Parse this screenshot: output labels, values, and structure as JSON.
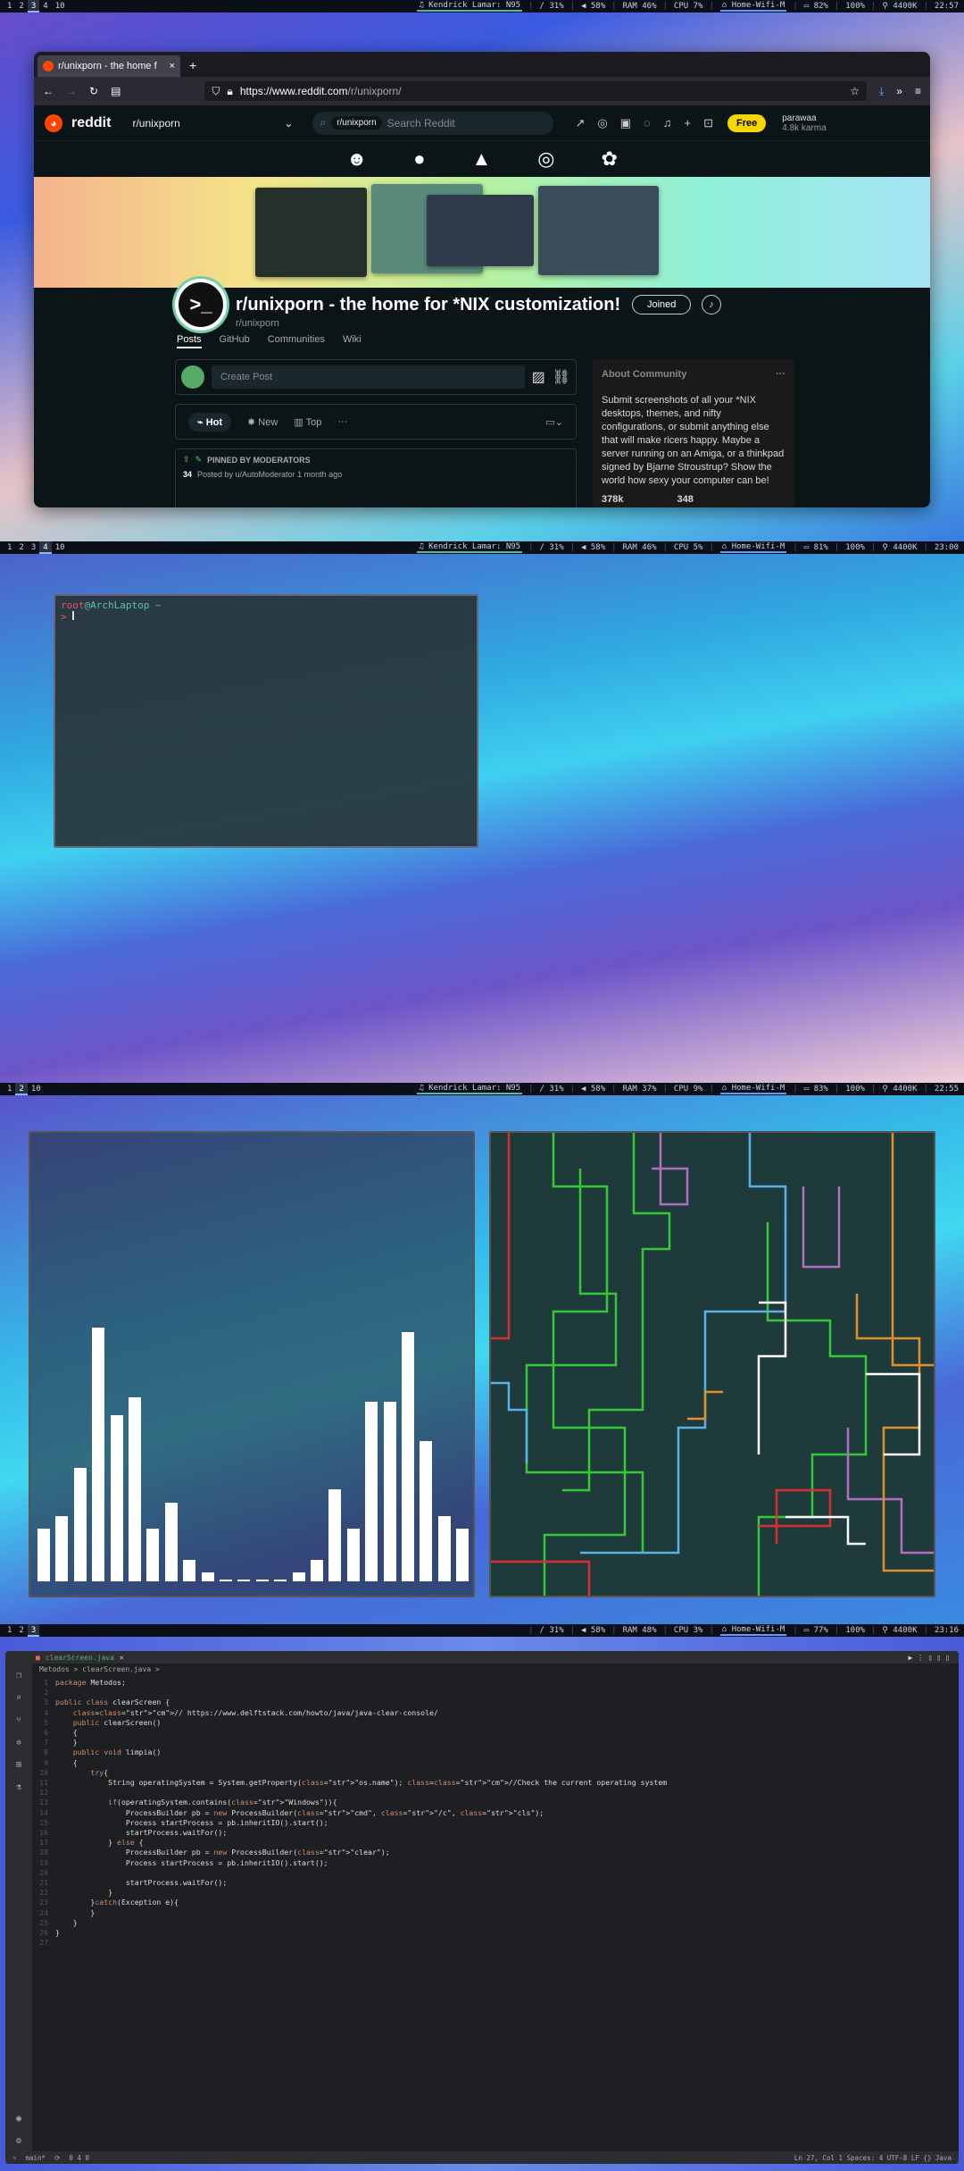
{
  "screens": [
    {
      "workspaces": [
        "1",
        "2",
        "3",
        "4",
        "10"
      ],
      "active": "3",
      "bar": {
        "song": "Kendrick Lamar: N95",
        "slash": "/ 31%",
        "volume": "58%",
        "ram": "RAM 46%",
        "cpu": "CPU  7%",
        "wifi": "Home-Wifi-M",
        "battery": "82%",
        "brightness": "100%",
        "temp": "4400K",
        "time": "22:57"
      }
    },
    {
      "workspaces": [
        "1",
        "2",
        "3",
        "4",
        "10"
      ],
      "active": "4",
      "bar": {
        "song": "Kendrick Lamar: N95",
        "slash": "/ 31%",
        "volume": "58%",
        "ram": "RAM 46%",
        "cpu": "CPU  5%",
        "wifi": "Home-Wifi-M",
        "battery": "81%",
        "brightness": "100%",
        "temp": "4400K",
        "time": "23:00"
      }
    },
    {
      "workspaces": [
        "1",
        "2",
        "10"
      ],
      "active": "2",
      "bar": {
        "song": "Kendrick Lamar: N95",
        "slash": "/ 31%",
        "volume": "58%",
        "ram": "RAM 37%",
        "cpu": "CPU  9%",
        "wifi": "Home-Wifi-M",
        "battery": "83%",
        "brightness": "100%",
        "temp": "4400K",
        "time": "22:55"
      }
    },
    {
      "workspaces": [
        "1",
        "2",
        "3"
      ],
      "active": "3",
      "bar": {
        "song": "",
        "slash": "/ 31%",
        "volume": "58%",
        "ram": "RAM 48%",
        "cpu": "CPU  3%",
        "wifi": "Home-Wifi-M",
        "battery": "77%",
        "brightness": "100%",
        "temp": "4400K",
        "time": "23:16"
      }
    }
  ],
  "browser": {
    "tab_title": "r/unixporn - the home f",
    "url_host": "https://www.reddit.com",
    "url_path": "/r/unixporn/",
    "site_name": "reddit",
    "sub_pill": "r/unixporn",
    "search_chip": "r/unixporn",
    "search_placeholder": "Search Reddit",
    "free_label": "Free",
    "username": "parawaa",
    "karma": "4.8k karma",
    "sub_title": "r/unixporn - the home for *NIX customization!",
    "sub_slug": "r/unixporn",
    "joined_label": "Joined",
    "subnav": [
      "Posts",
      "GitHub",
      "Communities",
      "Wiki"
    ],
    "create_post": "Create Post",
    "sort": {
      "hot": "Hot",
      "new": "New",
      "top": "Top"
    },
    "pinned": "PINNED BY MODERATORS",
    "posted_by": "Posted by u/AutoModerator 1 month ago",
    "votes": "34",
    "about_title": "About Community",
    "about_text": "Submit screenshots of all your *NIX desktops, themes, and nifty configurations, or submit anything else that will make ricers happy. Maybe a server running on an Amiga, or a thinkpad signed by Bjarne Stroustrup? Show the world how sexy your computer can be!",
    "members": "378k",
    "online": "348"
  },
  "terminal": {
    "user": "root",
    "host": "@ArchLaptop",
    "path": "~"
  },
  "visualizer": {
    "levels": [
      0.12,
      0.15,
      0.26,
      0.58,
      0.38,
      0.42,
      0.12,
      0.18,
      0.05,
      0.02,
      0.005,
      0.005,
      0.005,
      0.005,
      0.02,
      0.05,
      0.21,
      0.12,
      0.41,
      0.41,
      0.57,
      0.32,
      0.15,
      0.12
    ]
  },
  "ide": {
    "tab": "clearScreen.java",
    "breadcrumb": "Metodos  >  clearScreen.java  >",
    "lines": [
      "package Metodos;",
      "",
      "public class clearScreen {",
      "    // https://www.delftstack.com/howto/java/java-clear-console/",
      "    public clearScreen()",
      "    {",
      "    }",
      "    public void limpia()",
      "    {",
      "        try{",
      "            String operatingSystem = System.getProperty(\"os.name\"); //Check the current operating system",
      "",
      "            if(operatingSystem.contains(\"Windows\")){",
      "                ProcessBuilder pb = new ProcessBuilder(\"cmd\", \"/c\", \"cls\");",
      "                Process startProcess = pb.inheritIO().start();",
      "                startProcess.waitFor();",
      "            } else {",
      "                ProcessBuilder pb = new ProcessBuilder(\"clear\");",
      "                Process startProcess = pb.inheritIO().start();",
      "",
      "                startProcess.waitFor();",
      "            }",
      "        }catch(Exception e){",
      "        }",
      "    }",
      "}",
      ""
    ],
    "status_left": "main*",
    "status_warn": "0 4 0",
    "status_right": "Ln 27, Col 1   Spaces: 4   UTF-8   LF   {} Java"
  }
}
